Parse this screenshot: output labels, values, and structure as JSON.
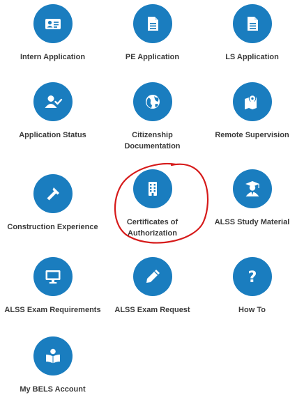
{
  "accent_color": "#1a7dbf",
  "annotation_color": "#d61a1a",
  "tiles": [
    {
      "label": "Intern Application",
      "icon": "id-card-icon"
    },
    {
      "label": "PE Application",
      "icon": "document-icon"
    },
    {
      "label": "LS Application",
      "icon": "document-icon"
    },
    {
      "label": "Application Status",
      "icon": "user-check-icon"
    },
    {
      "label": "Citizenship Documentation",
      "icon": "globe-icon"
    },
    {
      "label": "Remote Supervision",
      "icon": "map-pin-icon"
    },
    {
      "label": "Construction Experience",
      "icon": "hammer-icon"
    },
    {
      "label": "Certificates of Authorization",
      "icon": "building-icon"
    },
    {
      "label": "ALSS Study Material",
      "icon": "graduate-icon"
    },
    {
      "label": "ALSS Exam Requirements",
      "icon": "monitor-icon"
    },
    {
      "label": "ALSS Exam Request",
      "icon": "pencil-icon"
    },
    {
      "label": "How To",
      "icon": "question-icon"
    },
    {
      "label": "My BELS Account",
      "icon": "book-reader-icon"
    }
  ]
}
